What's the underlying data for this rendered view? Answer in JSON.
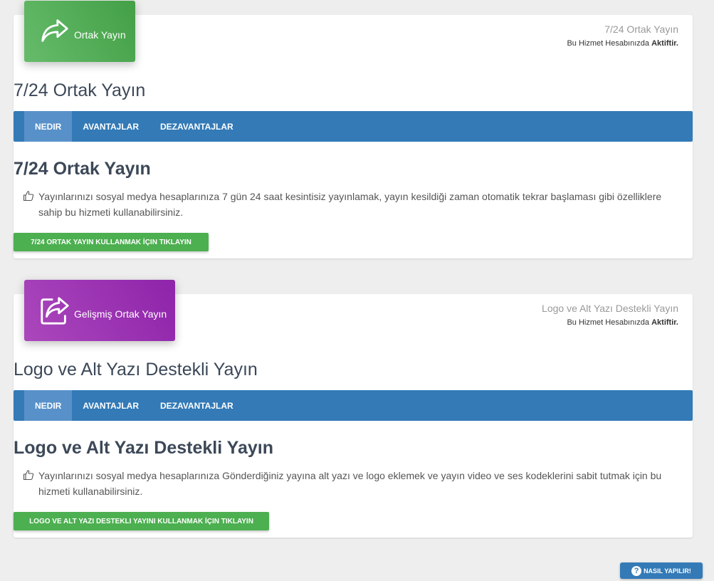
{
  "cards": [
    {
      "badge_label": "Ortak Yayın",
      "badge_icon": "share-arrow-icon",
      "meta_title": "7/24 Ortak Yayın",
      "status_prefix": "Bu Hizmet Hesabınızda",
      "status_value": "Aktiftir.",
      "title": "7/24 Ortak Yayın",
      "tabs": [
        "NEDIR",
        "AVANTAJLAR",
        "DEZAVANTAJLAR"
      ],
      "section_title": "7/24 Ortak Yayın",
      "description": "Yayınlarınızı sosyal medya hesaplarınıza 7 gün 24 saat kesintisiz yayınlamak, yayın kesildiği zaman otomatik tekrar başlaması gibi özelliklere sahip bu hizmeti kullanabilirsiniz.",
      "button": "7/24 ORTAK YAYIN KULLANMAK İÇIN TIKLAYIN"
    },
    {
      "badge_label": "Gelişmiş Ortak Yayın",
      "badge_icon": "share-square-icon",
      "meta_title": "Logo ve Alt Yazı Destekli Yayın",
      "status_prefix": "Bu Hizmet Hesabınızda",
      "status_value": "Aktiftir.",
      "title": "Logo ve Alt Yazı Destekli Yayın",
      "tabs": [
        "NEDIR",
        "AVANTAJLAR",
        "DEZAVANTAJLAR"
      ],
      "section_title": "Logo ve Alt Yazı Destekli Yayın",
      "description": "Yayınlarınızı sosyal medya hesaplarınıza Gönderdiğiniz yayına alt yazı ve logo eklemek ve yayın video ve ses kodeklerini sabit tutmak için bu hizmeti kullanabilirsiniz.",
      "button": "LOGO VE ALT YAZI DESTEKLI YAYINI KULLANMAK İÇIN TIKLAYIN"
    }
  ],
  "help_button": "NASIL YAPILIR!",
  "colors": {
    "green": "#4caf50",
    "purple": "#9c27b0",
    "blue": "#337ab7",
    "active_tab": "#5891c9"
  }
}
